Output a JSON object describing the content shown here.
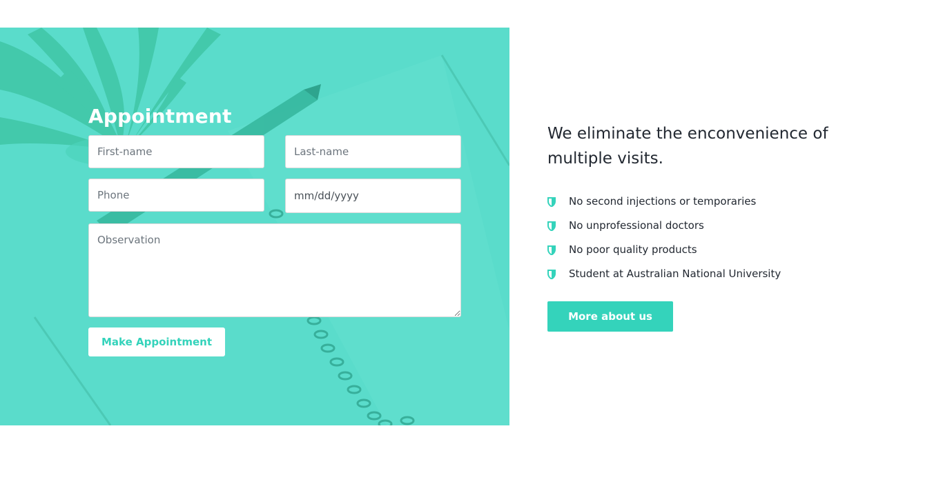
{
  "appointment": {
    "title": "Appointment",
    "first_name_placeholder": "First-name",
    "last_name_placeholder": "Last-name",
    "phone_placeholder": "Phone",
    "date_value": "mm/dd/yyyy",
    "observation_placeholder": "Observation",
    "submit_label": "Make Appointment"
  },
  "about": {
    "headline": "We eliminate the enconvenience of multiple visits.",
    "features": [
      {
        "icon": "shield-icon",
        "label": "No second injections or temporaries"
      },
      {
        "icon": "shield-icon",
        "label": "No unprofessional doctors"
      },
      {
        "icon": "shield-icon",
        "label": "No poor quality products"
      },
      {
        "icon": "shield-icon",
        "label": "Student at Australian National University"
      }
    ],
    "more_label": "More about us"
  },
  "colors": {
    "accent": "#34d3bb",
    "hero_overlay": "#5adccb",
    "text_dark": "#222831"
  }
}
